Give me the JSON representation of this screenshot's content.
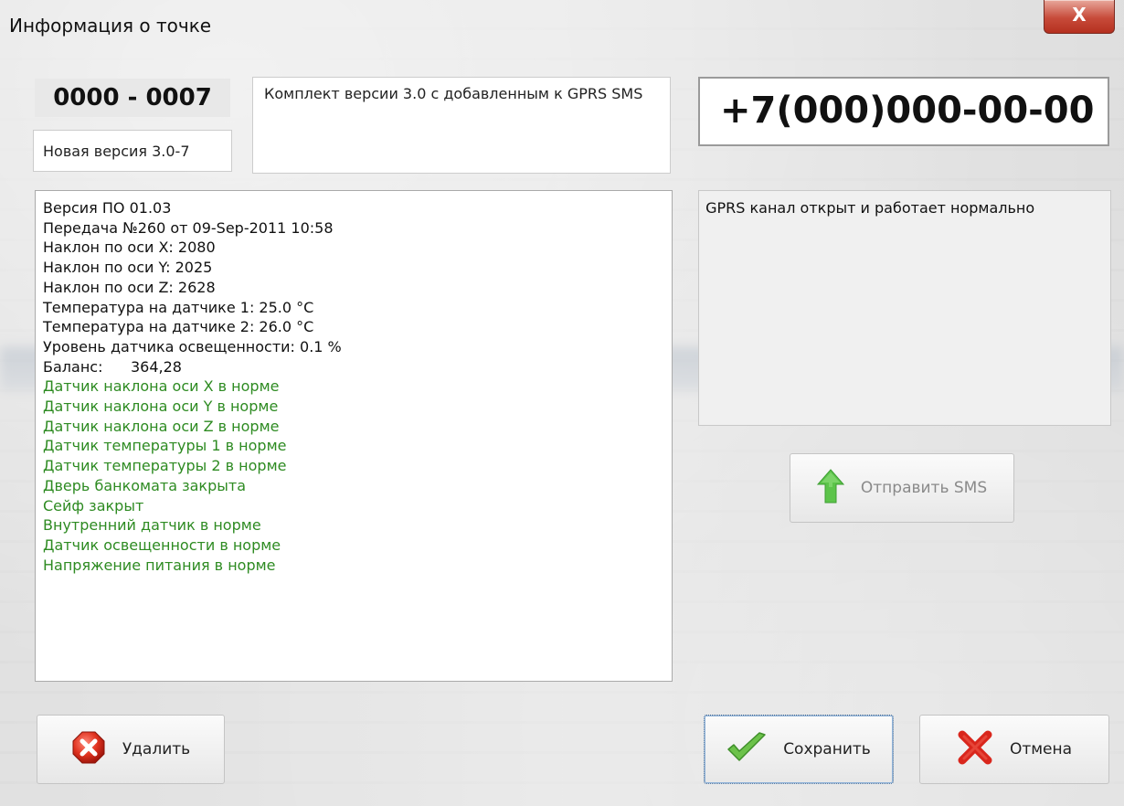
{
  "window": {
    "title": "Информация о точке",
    "close_label": "X"
  },
  "point": {
    "id": "0000 - 0007",
    "version_name": "Новая версия 3.0-7",
    "description": "Комплект версии 3.0 с добавленным к GPRS SMS",
    "phone": "+7(000)000-00-00"
  },
  "info_lines": [
    "Версия ПО 01.03",
    "Передача №260 от 09-Sep-2011 10:58",
    "Наклон по оси X: 2080",
    "Наклон по оси Y: 2025",
    "Наклон по оси Z: 2628",
    "Температура на датчике 1: 25.0 °C",
    "Температура на датчике 2: 26.0 °C",
    "Уровень датчика освещенности: 0.1 %",
    "Баланс:      364,28"
  ],
  "status_lines": [
    "Датчик наклона оси X в норме",
    "Датчик наклона оси Y в норме",
    "Датчик наклона оси Z в норме",
    "Датчик температуры 1 в норме",
    "Датчик температуры 2 в норме",
    "Дверь банкомата закрыта",
    "Сейф закрыт",
    "Внутренний датчик в норме",
    "Датчик освещенности в норме",
    "Напряжение питания в норме"
  ],
  "gprs_status": " GPRS канал открыт и работает нормально",
  "buttons": {
    "send_sms": "Отправить SMS",
    "delete": "Удалить",
    "save": "Сохранить",
    "cancel": "Отмена"
  },
  "colors": {
    "ok_text": "#2e8b22",
    "close_button": "#c74b3a"
  }
}
